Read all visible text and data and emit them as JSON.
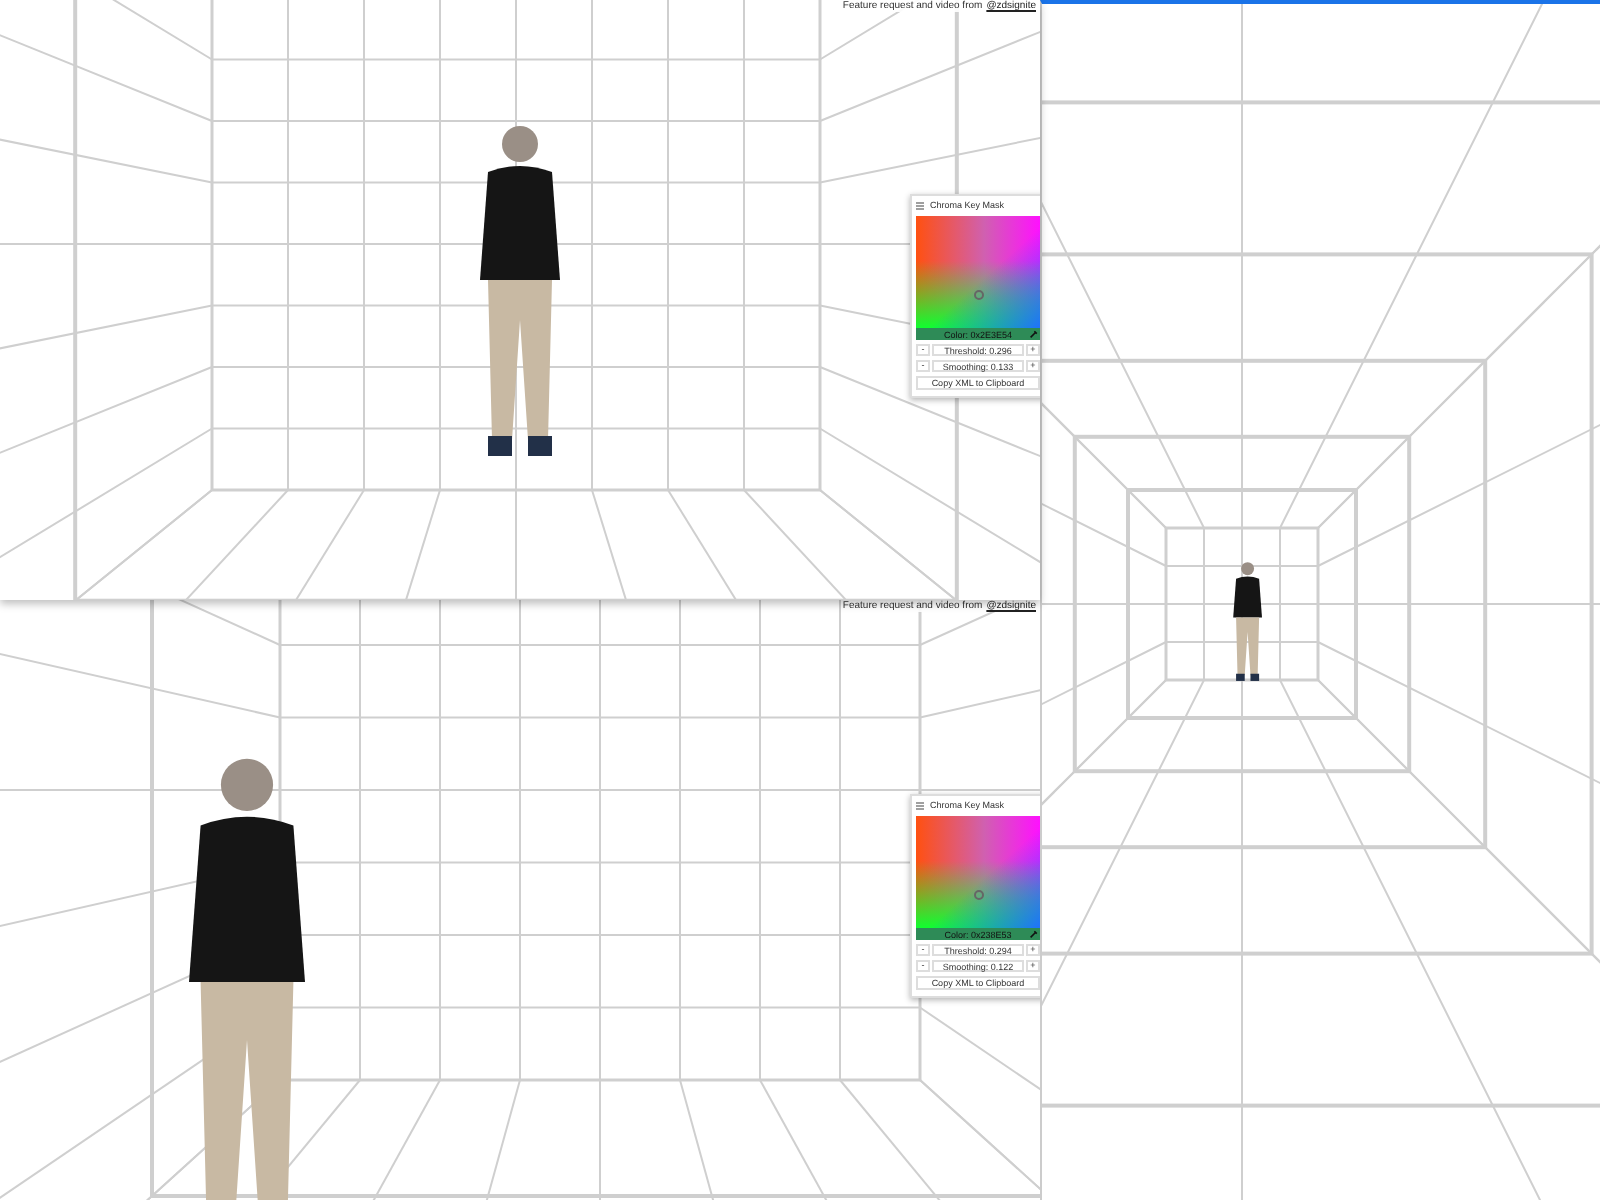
{
  "views": [
    {
      "kind": "front",
      "focused": false,
      "caption": {
        "text": "Feature request and video from",
        "link": "@zdsignite"
      },
      "panel": {
        "title": "Chroma Key Mask",
        "color_label": "Color: 0x2E3E54",
        "threshold": "Threshold: 0.296",
        "smoothing": "Smoothing: 0.133",
        "minus": "-",
        "plus": "+",
        "copy_button": "Copy XML to Clipboard"
      }
    },
    {
      "kind": "tunnel",
      "focused": true
    },
    {
      "kind": "perspective",
      "focused": false,
      "caption": {
        "text": "Feature request and video from",
        "link": "@zdsignite"
      },
      "panel": {
        "title": "Chroma Key Mask",
        "color_label": "Color: 0x238E53",
        "threshold": "Threshold: 0.294",
        "smoothing": "Smoothing: 0.122",
        "minus": "-",
        "plus": "+",
        "copy_button": "Copy XML to Clipboard"
      }
    }
  ]
}
